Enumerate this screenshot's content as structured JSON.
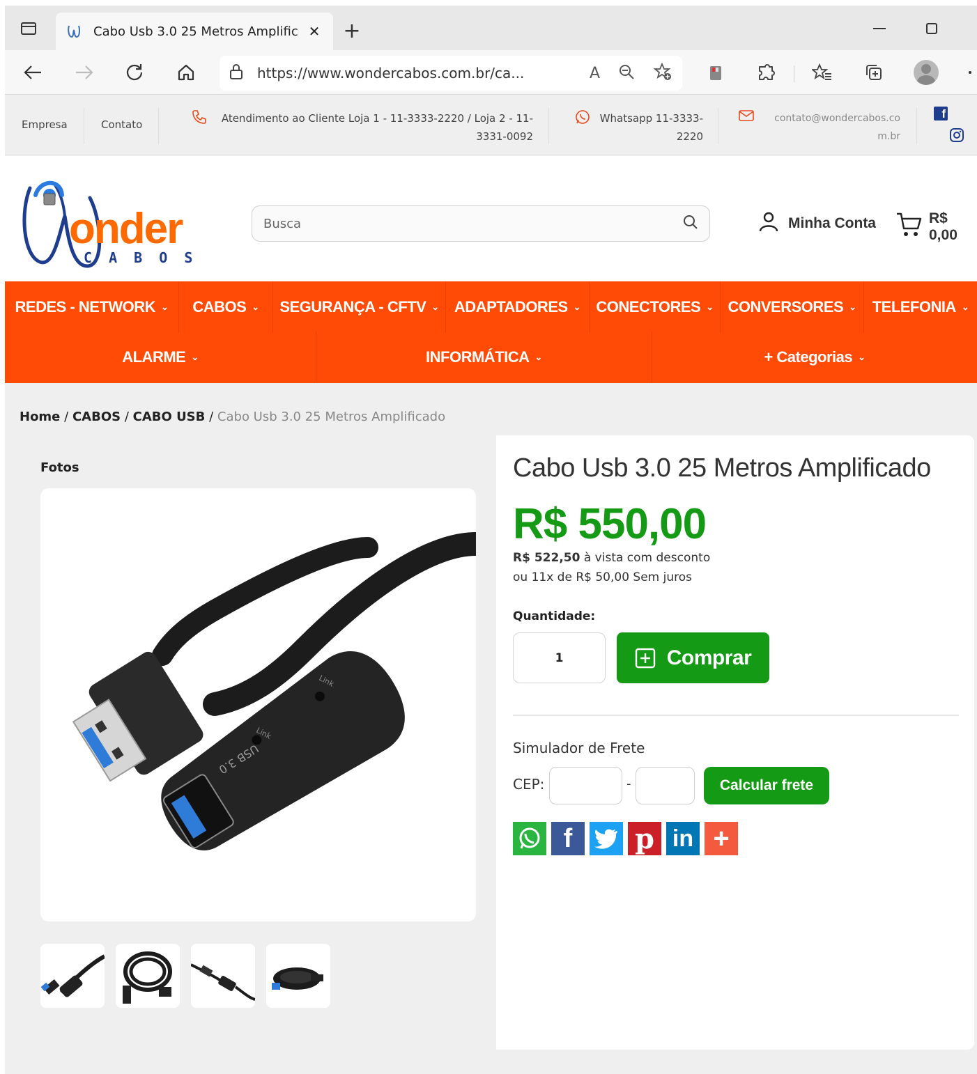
{
  "browser": {
    "tab_title": "Cabo Usb 3.0 25 Metros Amplific",
    "url": "https://www.wondercabos.com.br/ca..."
  },
  "topbar": {
    "links": [
      "Empresa",
      "Contato"
    ],
    "phone_line1": "Atendimento ao Cliente Loja 1 - 11-3333-2220 / Loja 2 - 11-",
    "phone_line2": "3331-0092",
    "whatsapp_line1": "Whatsapp 11-3333-",
    "whatsapp_line2": "2220",
    "email_line1": "contato@wondercabos.co",
    "email_line2": "m.br"
  },
  "header": {
    "logo_text": "onder",
    "logo_sub": "C A B O S",
    "search_placeholder": "Busca",
    "account_label": "Minha Conta",
    "cart_total": "R$ 0,00"
  },
  "categories": {
    "row1": [
      "REDES - NETWORK",
      "CABOS",
      "SEGURANÇA - CFTV",
      "ADAPTADORES",
      "CONECTORES",
      "CONVERSORES",
      "TELEFONIA"
    ],
    "row2": [
      "ALARME",
      "INFORMÁTICA",
      "+ Categorias"
    ]
  },
  "breadcrumb": {
    "home": "Home",
    "level1": "CABOS",
    "level2": "CABO USB",
    "current": "Cabo Usb 3.0 25 Metros Amplificado",
    "sep": "/"
  },
  "product": {
    "photos_label": "Fotos",
    "title": "Cabo Usb 3.0 25 Metros Amplificado",
    "price": "R$ 550,00",
    "cash_price": "R$ 522,50",
    "cash_text": "à vista com desconto",
    "installments": "ou 11x de R$ 50,00 Sem juros",
    "quantity_label": "Quantidade:",
    "quantity_value": "1",
    "buy_label": "Comprar",
    "usb_label": "USB 3.0",
    "link_label": "Link"
  },
  "shipping": {
    "title": "Simulador de Frete",
    "cep_label": "CEP:",
    "dash": "-",
    "button": "Calcular frete"
  },
  "share": {
    "icons": [
      "whatsapp-icon",
      "facebook-icon",
      "twitter-icon",
      "pinterest-icon",
      "linkedin-icon",
      "more-share-icon"
    ],
    "colors": [
      "#2ab540",
      "#3b5998",
      "#1da1f2",
      "#cb2027",
      "#0077b5",
      "#f45a3e"
    ]
  },
  "colors": {
    "brand_orange": "#ff4b06",
    "price_green": "#149a14",
    "logo_blue": "#1f3d8f"
  }
}
